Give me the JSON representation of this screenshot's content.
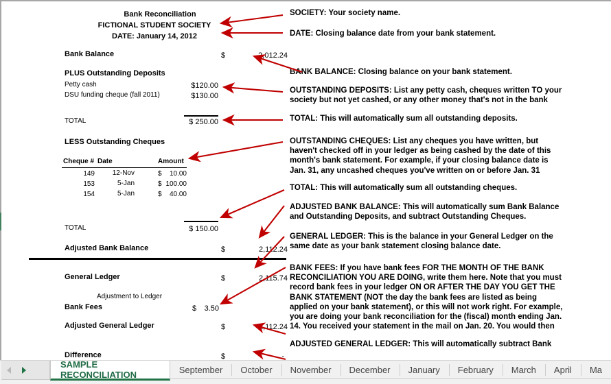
{
  "sheet": {
    "title_line1": "Bank Reconciliation",
    "title_line2": "FICTIONAL STUDENT SOCIETY",
    "title_line3": "DATE: January 14, 2012",
    "bank_balance_label": "Bank Balance",
    "bank_balance_dollar": "$",
    "bank_balance_amount": "2,012.24",
    "deposits_heading": "PLUS Outstanding Deposits",
    "deposits": [
      {
        "label": "Petty cash",
        "amount": "$120.00"
      },
      {
        "label": "DSU funding cheque (fall 2011)",
        "amount": "$130.00"
      }
    ],
    "deposits_total_label": "TOTAL",
    "deposits_total_amount": "$ 250.00",
    "cheques_heading": "LESS Outstanding Cheques",
    "cheques_columns": {
      "number": "Cheque #",
      "date": "Date",
      "amount": "Amount"
    },
    "cheques": [
      {
        "number": "149",
        "date": "12-Nov",
        "dollar": "$",
        "amount": "10.00"
      },
      {
        "number": "153",
        "date": "5-Jan",
        "dollar": "$",
        "amount": "100.00"
      },
      {
        "number": "154",
        "date": "5-Jan",
        "dollar": "$",
        "amount": "40.00"
      }
    ],
    "cheques_total_label": "TOTAL",
    "cheques_total_amount": "$ 150.00",
    "adjusted_bank_balance_label": "Adjusted Bank Balance",
    "adjusted_bank_balance_dollar": "$",
    "adjusted_bank_balance_amount": "2,112.24",
    "general_ledger_label": "General Ledger",
    "general_ledger_dollar": "$",
    "general_ledger_amount": "2,115.74",
    "adjustment_to_ledger_label": "Adjustment to Ledger",
    "bank_fees_label": "Bank Fees",
    "bank_fees_dollar": "$",
    "bank_fees_amount": "3.50",
    "adjusted_general_ledger_label": "Adjusted General Ledger",
    "adjusted_general_ledger_dollar": "$",
    "adjusted_general_ledger_amount": "2,112.24",
    "difference_label": "Difference",
    "difference_dollar": "$",
    "difference_amount": "-"
  },
  "notes": {
    "society": "SOCIETY: Your society name.",
    "date": "DATE: Closing balance date from your bank statement.",
    "bank_balance": "BANK BALANCE: Closing balance on your bank statement.",
    "outstanding_deposits": "OUTSTANDING DEPOSITS: List any petty cash, cheques written TO your\nsociety but not yet cashed, or any other money that's not in the bank",
    "deposits_total": "TOTAL: This will automatically sum all outstanding deposits.",
    "outstanding_cheques": "OUTSTANDING CHEQUES: List any cheques you have written, but\nhaven't checked off in your ledger as being cashed by the date of this\nmonth's bank statement. For example, if your closing balance date is\nJan. 31, any uncashed cheques you've written on or before Jan. 31",
    "cheques_total": "TOTAL: This will automatically sum all outstanding cheques.",
    "adjusted_bank_balance": "ADJUSTED BANK BALANCE: This will automatically sum Bank Balance\nand Outstanding Deposits, and subtract Outstanding Cheques.",
    "general_ledger": "GENERAL LEDGER: This is the balance in your General Ledger on the\nsame date as your bank statement closing balance date.",
    "bank_fees": "BANK FEES: If you have bank fees FOR THE MONTH OF THE BANK\nRECONCILIATION YOU ARE DOING, write them here. Note that you must\nrecord bank fees in your ledger ON OR AFTER THE DAY YOU GET THE\nBANK STATEMENT (NOT the day the bank fees are listed as being\napplied on your bank statement), or this will not work right. For example,\nyou are doing your bank reconciliation for the (fiscal) month ending Jan.\n14. You received your statement in the mail on Jan. 20. You would then",
    "adjusted_general_ledger": "ADJUSTED GENERAL LEDGER: This will automatically subtract Bank"
  },
  "tabbar": {
    "prev_icon": "triangle-left-icon",
    "next_icon": "triangle-right-icon",
    "tabs": [
      {
        "label": "SAMPLE RECONCILIATION",
        "active": true
      },
      {
        "label": "September",
        "active": false
      },
      {
        "label": "October",
        "active": false
      },
      {
        "label": "November",
        "active": false
      },
      {
        "label": "December",
        "active": false
      },
      {
        "label": "January",
        "active": false
      },
      {
        "label": "February",
        "active": false
      },
      {
        "label": "March",
        "active": false
      },
      {
        "label": "April",
        "active": false
      },
      {
        "label": "Ma",
        "active": false
      }
    ]
  },
  "colors": {
    "accent_green": "#217346",
    "annotation_red": "#c00000",
    "text_black": "#000000",
    "tabbar_bg": "#f1f1f1"
  }
}
